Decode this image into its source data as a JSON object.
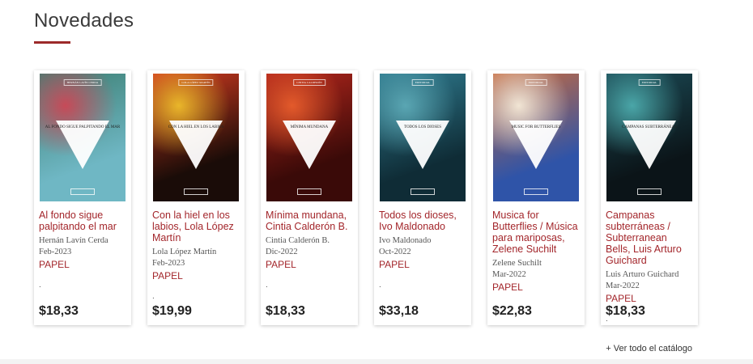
{
  "section": {
    "title": "Novedades",
    "see_all": "+ Ver todo el catálogo"
  },
  "books": [
    {
      "title": "Al fondo sigue palpitando el mar",
      "author": "Hernán Lavín Cerda",
      "date": "Feb-2023",
      "format": "PAPEL",
      "dot": ".",
      "price": "$18,33",
      "cover_text": "AL FONDO SIGUE PALPITANDO EL MAR",
      "cover_band": "HERNÁN LAVÍN CERDA",
      "cover_colors": [
        "#6fb7c4",
        "#3d7f73",
        "#c74a58"
      ]
    },
    {
      "title": "Con la hiel en los labios, Lola López Martín",
      "author": "Lola López Martín",
      "date": "Feb-2023",
      "format": "PAPEL",
      "dot": ".",
      "price": "$19,99",
      "cover_text": "CON LA HIEL EN LOS LABIOS",
      "cover_band": "LOLA LÓPEZ MARTÍN",
      "cover_colors": [
        "#1a0c08",
        "#d23a1f",
        "#e9b62a"
      ]
    },
    {
      "title": "Mínima mundana, Cintia Calderón B.",
      "author": "Cintia Calderón B.",
      "date": "Dic-2022",
      "format": "PAPEL",
      "dot": ".",
      "price": "$18,33",
      "cover_text": "MÍNIMA MUNDANA",
      "cover_band": "CINTIA CALDERÓN",
      "cover_colors": [
        "#3a0a08",
        "#b3261c",
        "#e35a2b"
      ]
    },
    {
      "title": "Todos los dioses, Ivo Maldonado",
      "author": "Ivo Maldonado",
      "date": "Oct-2022",
      "format": "PAPEL",
      "dot": ".",
      "price": "$33,18",
      "cover_text": "TODOS LOS DIOSES",
      "cover_band": "EDITORIAL",
      "cover_colors": [
        "#0f2c36",
        "#2f7b8f",
        "#5aa6b3"
      ]
    },
    {
      "title": "Musica for Butterflies / Música para mariposas, Zelene Suchilt",
      "author": "Zelene Suchilt",
      "date": "Mar-2022",
      "format": "PAPEL",
      "dot": ".",
      "price": "$22,83",
      "cover_text": "MUSIC FOR BUTTERFLIES",
      "cover_band": "EDITORIAL",
      "cover_colors": [
        "#2f54a8",
        "#c56a3f",
        "#f1e5d4"
      ]
    },
    {
      "title": "Campanas subterráneas / Subterranean Bells, Luis Arturo Guichard",
      "author": "Luis Arturo Guichard",
      "date": "Mar-2022",
      "format": "PAPEL",
      "dot": ".",
      "price": "$18,33",
      "cover_text": "CAMPANAS SUBTERRÁNEAS",
      "cover_band": "EDITORIAL",
      "cover_colors": [
        "#0b1418",
        "#1b4a55",
        "#4aa6a8"
      ]
    }
  ]
}
